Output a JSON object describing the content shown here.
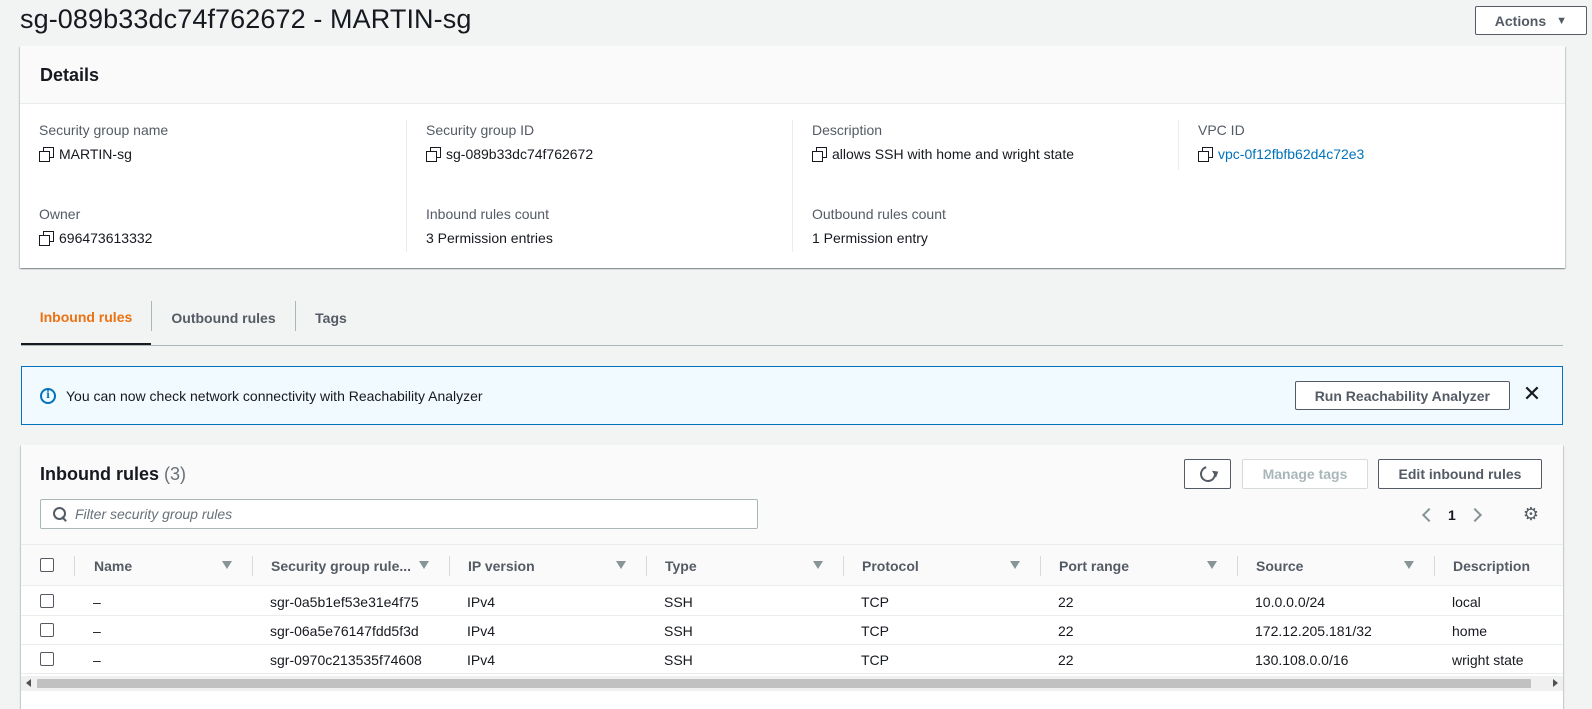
{
  "header": {
    "title": "sg-089b33dc74f762672 - MARTIN-sg",
    "actions_label": "Actions",
    "actions_caret": "▼"
  },
  "details": {
    "title": "Details",
    "fields": {
      "sg_name": {
        "label": "Security group name",
        "value": "MARTIN-sg"
      },
      "sg_id": {
        "label": "Security group ID",
        "value": "sg-089b33dc74f762672"
      },
      "description": {
        "label": "Description",
        "value": "allows SSH with home and wright state"
      },
      "vpc_id": {
        "label": "VPC ID",
        "value": "vpc-0f12fbfb62d4c72e3"
      },
      "owner": {
        "label": "Owner",
        "value": "696473613332"
      },
      "inbound_count": {
        "label": "Inbound rules count",
        "value": "3 Permission entries"
      },
      "outbound_count": {
        "label": "Outbound rules count",
        "value": "1 Permission entry"
      }
    }
  },
  "tabs": [
    {
      "label": "Inbound rules",
      "active": true
    },
    {
      "label": "Outbound rules",
      "active": false
    },
    {
      "label": "Tags",
      "active": false
    }
  ],
  "flash": {
    "icon": "info-icon",
    "icon_glyph": "i",
    "text": "You can now check network connectivity with Reachability Analyzer",
    "button_label": "Run Reachability Analyzer",
    "close_glyph": "✕"
  },
  "inbound": {
    "title": "Inbound rules",
    "count": "(3)",
    "manage_tags_label": "Manage tags",
    "edit_label": "Edit inbound rules",
    "filter_placeholder": "Filter security group rules",
    "page": "1",
    "gear_glyph": "⚙",
    "columns": [
      "Name",
      "Security group rule...",
      "IP version",
      "Type",
      "Protocol",
      "Port range",
      "Source",
      "Description"
    ],
    "rows": [
      [
        "–",
        "sgr-0a5b1ef53e31e4f75",
        "IPv4",
        "SSH",
        "TCP",
        "22",
        "10.0.0.0/24",
        "local"
      ],
      [
        "–",
        "sgr-06a5e76147fdd5f3d",
        "IPv4",
        "SSH",
        "TCP",
        "22",
        "172.12.205.181/32",
        "home"
      ],
      [
        "–",
        "sgr-0970c213535f74608",
        "IPv4",
        "SSH",
        "TCP",
        "22",
        "130.108.0.0/16",
        "wright state"
      ]
    ]
  },
  "colors": {
    "accent_tab": "#ec7211",
    "link": "#0073bb",
    "flash_bg": "#f1faff",
    "flash_border": "#0073bb"
  }
}
